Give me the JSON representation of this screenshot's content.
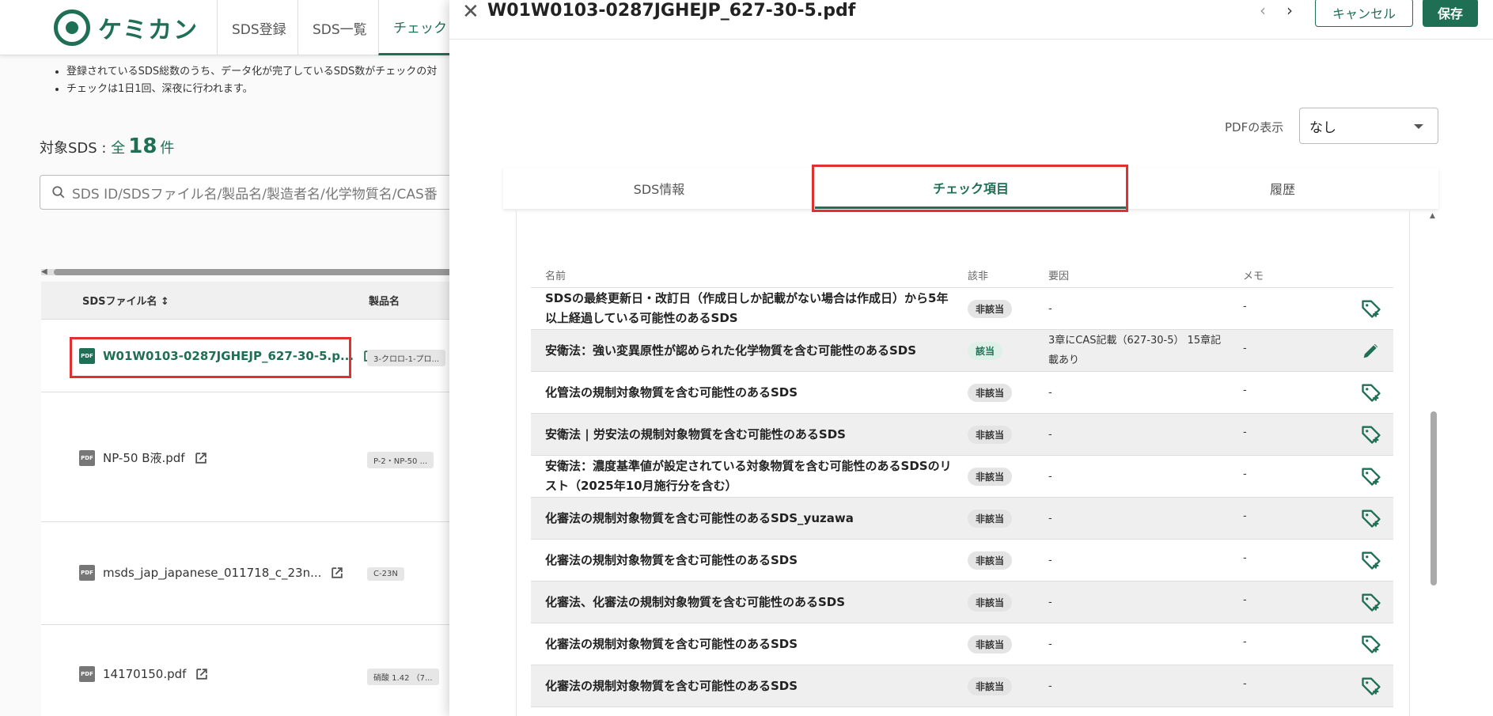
{
  "app": {
    "logo_text": "ケミカン",
    "nav_tabs": [
      "SDS登録",
      "SDS一覧",
      "チェック"
    ]
  },
  "notes": [
    "登録されているSDS総数のうち、データ化が完了しているSDS数がチェックの対",
    "チェックは1日1回、深夜に行われます。"
  ],
  "target": {
    "prefix": "対象SDS : ",
    "all": "全",
    "count": "18",
    "unit": "件"
  },
  "search": {
    "placeholder": "SDS ID/SDSファイル名/製品名/製造者名/化学物質名/CAS番"
  },
  "file_table": {
    "headers": [
      "SDSファイル名",
      "製品名"
    ],
    "rows": [
      {
        "name": "W01W0103-0287JGHEJP_627-30-5.p...",
        "product": "3-クロロ-1-プロ..."
      },
      {
        "name": "NP-50 B液.pdf",
        "product": "P-2・NP-50 ..."
      },
      {
        "name": "msds_jap_japanese_011718_c_23n...",
        "product": "C-23N"
      },
      {
        "name": "14170150.pdf",
        "product": "硝酸 1.42 （7..."
      }
    ]
  },
  "panel": {
    "title": "W01W0103-0287JGHEJP_627-30-5.pdf",
    "close_icon": "close-icon",
    "cancel_label": "キャンセル",
    "save_label": "保存",
    "pdf_display_label": "PDFの表示",
    "pdf_display_value": "なし",
    "tabs": [
      "SDS情報",
      "チェック項目",
      "履歴"
    ],
    "list_headers": {
      "name": "名前",
      "status": "該非",
      "cause": "要因",
      "memo": "メモ"
    },
    "items": [
      {
        "name": "SDSの最終更新日・改訂日（作成日しか記載がない場合は作成日）から5年以上経過している可能性のあるSDS",
        "status": "非該当",
        "cause": "-",
        "memo": "-",
        "action": "tag-plus-icon"
      },
      {
        "name": "安衛法：強い変異原性が認められた化学物質を含む可能性のあるSDS",
        "status": "該当",
        "cause": "3章にCAS記載（627-30-5） 15章記載あり",
        "memo": "-",
        "action": "pencil-icon"
      },
      {
        "name": "化管法の規制対象物質を含む可能性のあるSDS",
        "status": "非該当",
        "cause": "-",
        "memo": "-",
        "action": "tag-plus-icon"
      },
      {
        "name": "安衛法 | 労安法の規制対象物質を含む可能性のあるSDS",
        "status": "非該当",
        "cause": "-",
        "memo": "-",
        "action": "tag-plus-icon"
      },
      {
        "name": "安衛法：濃度基準値が設定されている対象物質を含む可能性のあるSDSのリスト（2025年10月施行分を含む）",
        "status": "非該当",
        "cause": "-",
        "memo": "-",
        "action": "tag-plus-icon"
      },
      {
        "name": "化審法の規制対象物質を含む可能性のあるSDS_yuzawa",
        "status": "非該当",
        "cause": "-",
        "memo": "-",
        "action": "tag-plus-icon"
      },
      {
        "name": "化審法の規制対象物質を含む可能性のあるSDS",
        "status": "非該当",
        "cause": "-",
        "memo": "-",
        "action": "tag-plus-icon"
      },
      {
        "name": "化審法、化審法の規制対象物質を含む可能性のあるSDS",
        "status": "非該当",
        "cause": "-",
        "memo": "-",
        "action": "tag-plus-icon"
      },
      {
        "name": "化審法の規制対象物質を含む可能性のあるSDS",
        "status": "非該当",
        "cause": "-",
        "memo": "-",
        "action": "tag-plus-icon"
      },
      {
        "name": "化審法の規制対象物質を含む可能性のあるSDS",
        "status": "非該当",
        "cause": "-",
        "memo": "-",
        "action": "tag-plus-icon"
      }
    ]
  },
  "colors": {
    "brand": "#1f6f55",
    "highlight": "#e03131"
  }
}
